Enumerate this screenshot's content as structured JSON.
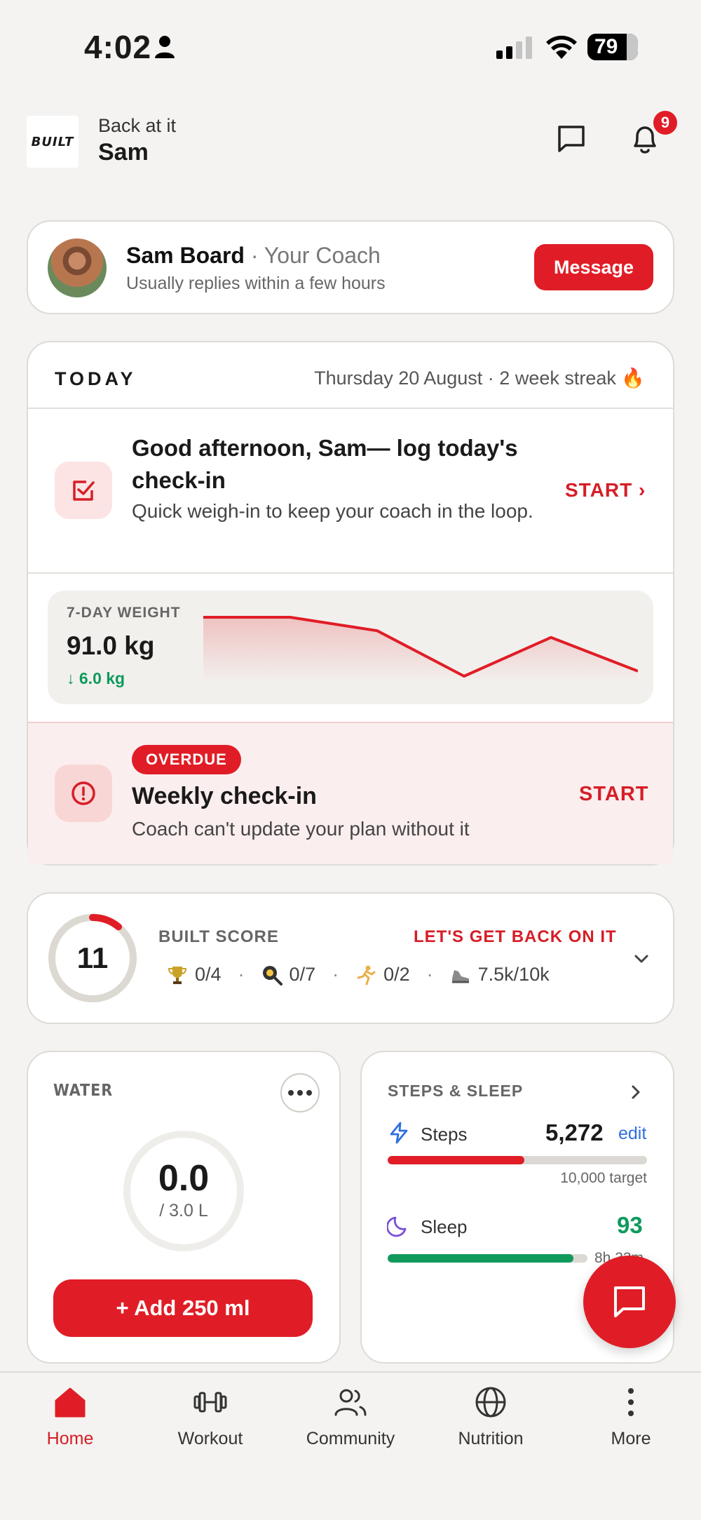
{
  "status_bar": {
    "time": "4:02",
    "battery": "79"
  },
  "header": {
    "logo_text": "BUILT",
    "greeting": "Back at it",
    "name": "Sam",
    "notification_count": "9"
  },
  "coach": {
    "name": "Sam Board",
    "separator": "·",
    "role": "Your Coach",
    "reply_note": "Usually replies within a few hours",
    "message_label": "Message"
  },
  "today": {
    "label": "TODAY",
    "date_streak": "Thursday 20 August · 2 week streak 🔥",
    "checkin": {
      "title": "Good afternoon, Sam— log today's check-in",
      "subtitle": "Quick weigh-in to keep your coach in the loop.",
      "action": "START ›"
    },
    "weight": {
      "label": "7-DAY WEIGHT",
      "value": "91.0 kg",
      "delta": "↓ 6.0 kg",
      "trend": [
        5,
        5,
        4.2,
        1.5,
        3.8,
        1.8
      ]
    },
    "weekly": {
      "badge": "OVERDUE",
      "title": "Weekly check-in",
      "subtitle": "Coach can't update your plan without it",
      "action": "START"
    }
  },
  "score": {
    "value": "11",
    "fraction": 0.11,
    "label": "BUILT SCORE",
    "cta": "LET'S GET BACK ON IT",
    "workouts": "0/4",
    "meals": "0/7",
    "cardio": "0/2",
    "steps": "7.5k/10k",
    "sep": "·"
  },
  "water": {
    "label": "WATER",
    "value": "0.0",
    "target": "/ 3.0 L",
    "add_label": "+ Add 250 ml",
    "fraction": 0
  },
  "steps_sleep": {
    "label": "STEPS & SLEEP",
    "steps_name": "Steps",
    "steps_value": "5,272",
    "edit_label": "edit",
    "steps_fraction": 0.5272,
    "steps_target": "10,000 target",
    "sleep_name": "Sleep",
    "sleep_score": "93",
    "sleep_fraction": 0.93,
    "sleep_time": "8h 33m"
  },
  "nav": {
    "home": "Home",
    "workout": "Workout",
    "community": "Community",
    "nutrition": "Nutrition",
    "more": "More"
  },
  "colors": {
    "accent": "#e01d26",
    "success": "#0f9a5c",
    "link": "#2f6fe0"
  }
}
